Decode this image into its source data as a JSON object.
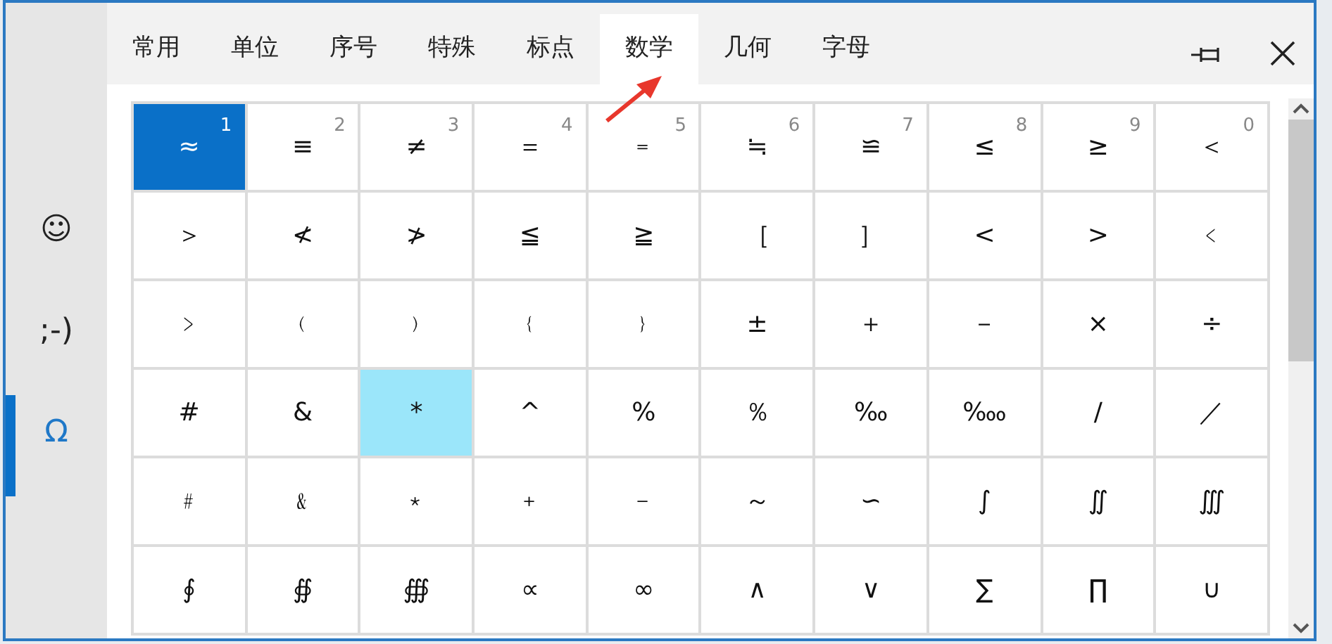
{
  "sidebar": {
    "items": [
      {
        "label": "☺",
        "selected": false
      },
      {
        "label": ";-)",
        "selected": false
      },
      {
        "label": "Ω",
        "selected": true
      }
    ]
  },
  "tabs": [
    {
      "label": "常用",
      "selected": false
    },
    {
      "label": "单位",
      "selected": false
    },
    {
      "label": "序号",
      "selected": false
    },
    {
      "label": "特殊",
      "selected": false
    },
    {
      "label": "标点",
      "selected": false
    },
    {
      "label": "数学",
      "selected": true
    },
    {
      "label": "几何",
      "selected": false
    },
    {
      "label": "字母",
      "selected": false
    }
  ],
  "grid": {
    "cells": [
      {
        "symbol": "≈",
        "index": "1",
        "selected": true,
        "hovered": false
      },
      {
        "symbol": "≡",
        "index": "2",
        "selected": false,
        "hovered": false
      },
      {
        "symbol": "≠",
        "index": "3",
        "selected": false,
        "hovered": false
      },
      {
        "symbol": "＝",
        "index": "4",
        "selected": false,
        "hovered": false
      },
      {
        "symbol": "﹦",
        "index": "5",
        "selected": false,
        "hovered": false
      },
      {
        "symbol": "≒",
        "index": "6",
        "selected": false,
        "hovered": false
      },
      {
        "symbol": "≌",
        "index": "7",
        "selected": false,
        "hovered": false
      },
      {
        "symbol": "≤",
        "index": "8",
        "selected": false,
        "hovered": false
      },
      {
        "symbol": "≥",
        "index": "9",
        "selected": false,
        "hovered": false
      },
      {
        "symbol": "＜",
        "index": "0",
        "selected": false,
        "hovered": false
      },
      {
        "symbol": "＞",
        "selected": false,
        "hovered": false
      },
      {
        "symbol": "≮",
        "selected": false,
        "hovered": false
      },
      {
        "symbol": "≯",
        "selected": false,
        "hovered": false
      },
      {
        "symbol": "≦",
        "selected": false,
        "hovered": false
      },
      {
        "symbol": "≧",
        "selected": false,
        "hovered": false
      },
      {
        "symbol": "［",
        "selected": false,
        "hovered": false
      },
      {
        "symbol": "］",
        "selected": false,
        "hovered": false
      },
      {
        "symbol": "<",
        "selected": false,
        "hovered": false
      },
      {
        "symbol": ">",
        "selected": false,
        "hovered": false
      },
      {
        "symbol": "﹤",
        "selected": false,
        "hovered": false
      },
      {
        "symbol": "﹥",
        "selected": false,
        "hovered": false
      },
      {
        "symbol": "﹙",
        "selected": false,
        "hovered": false
      },
      {
        "symbol": "﹚",
        "selected": false,
        "hovered": false
      },
      {
        "symbol": "﹛",
        "selected": false,
        "hovered": false
      },
      {
        "symbol": "﹜",
        "selected": false,
        "hovered": false
      },
      {
        "symbol": "±",
        "selected": false,
        "hovered": false
      },
      {
        "symbol": "＋",
        "selected": false,
        "hovered": false
      },
      {
        "symbol": "－",
        "selected": false,
        "hovered": false
      },
      {
        "symbol": "×",
        "selected": false,
        "hovered": false
      },
      {
        "symbol": "÷",
        "selected": false,
        "hovered": false
      },
      {
        "symbol": "#",
        "selected": false,
        "hovered": false
      },
      {
        "symbol": "&",
        "selected": false,
        "hovered": false
      },
      {
        "symbol": "*",
        "selected": false,
        "hovered": true
      },
      {
        "symbol": "^",
        "selected": false,
        "hovered": false
      },
      {
        "symbol": "%",
        "selected": false,
        "hovered": false
      },
      {
        "symbol": "％",
        "selected": false,
        "hovered": false
      },
      {
        "symbol": "‰",
        "selected": false,
        "hovered": false
      },
      {
        "symbol": "‱",
        "selected": false,
        "hovered": false
      },
      {
        "symbol": "∕",
        "selected": false,
        "hovered": false
      },
      {
        "symbol": "／",
        "selected": false,
        "hovered": false
      },
      {
        "symbol": "﹟",
        "selected": false,
        "hovered": false
      },
      {
        "symbol": "﹠",
        "selected": false,
        "hovered": false
      },
      {
        "symbol": "﹡",
        "selected": false,
        "hovered": false
      },
      {
        "symbol": "﹢",
        "selected": false,
        "hovered": false
      },
      {
        "symbol": "﹣",
        "selected": false,
        "hovered": false
      },
      {
        "symbol": "～",
        "selected": false,
        "hovered": false
      },
      {
        "symbol": "∽",
        "selected": false,
        "hovered": false
      },
      {
        "symbol": "∫",
        "selected": false,
        "hovered": false
      },
      {
        "symbol": "∬",
        "selected": false,
        "hovered": false
      },
      {
        "symbol": "∭",
        "selected": false,
        "hovered": false
      },
      {
        "symbol": "∮",
        "selected": false,
        "hovered": false
      },
      {
        "symbol": "∯",
        "selected": false,
        "hovered": false
      },
      {
        "symbol": "∰",
        "selected": false,
        "hovered": false
      },
      {
        "symbol": "∝",
        "selected": false,
        "hovered": false
      },
      {
        "symbol": "∞",
        "selected": false,
        "hovered": false
      },
      {
        "symbol": "∧",
        "selected": false,
        "hovered": false
      },
      {
        "symbol": "∨",
        "selected": false,
        "hovered": false
      },
      {
        "symbol": "∑",
        "selected": false,
        "hovered": false
      },
      {
        "symbol": "∏",
        "selected": false,
        "hovered": false
      },
      {
        "symbol": "∪",
        "selected": false,
        "hovered": false
      }
    ]
  }
}
